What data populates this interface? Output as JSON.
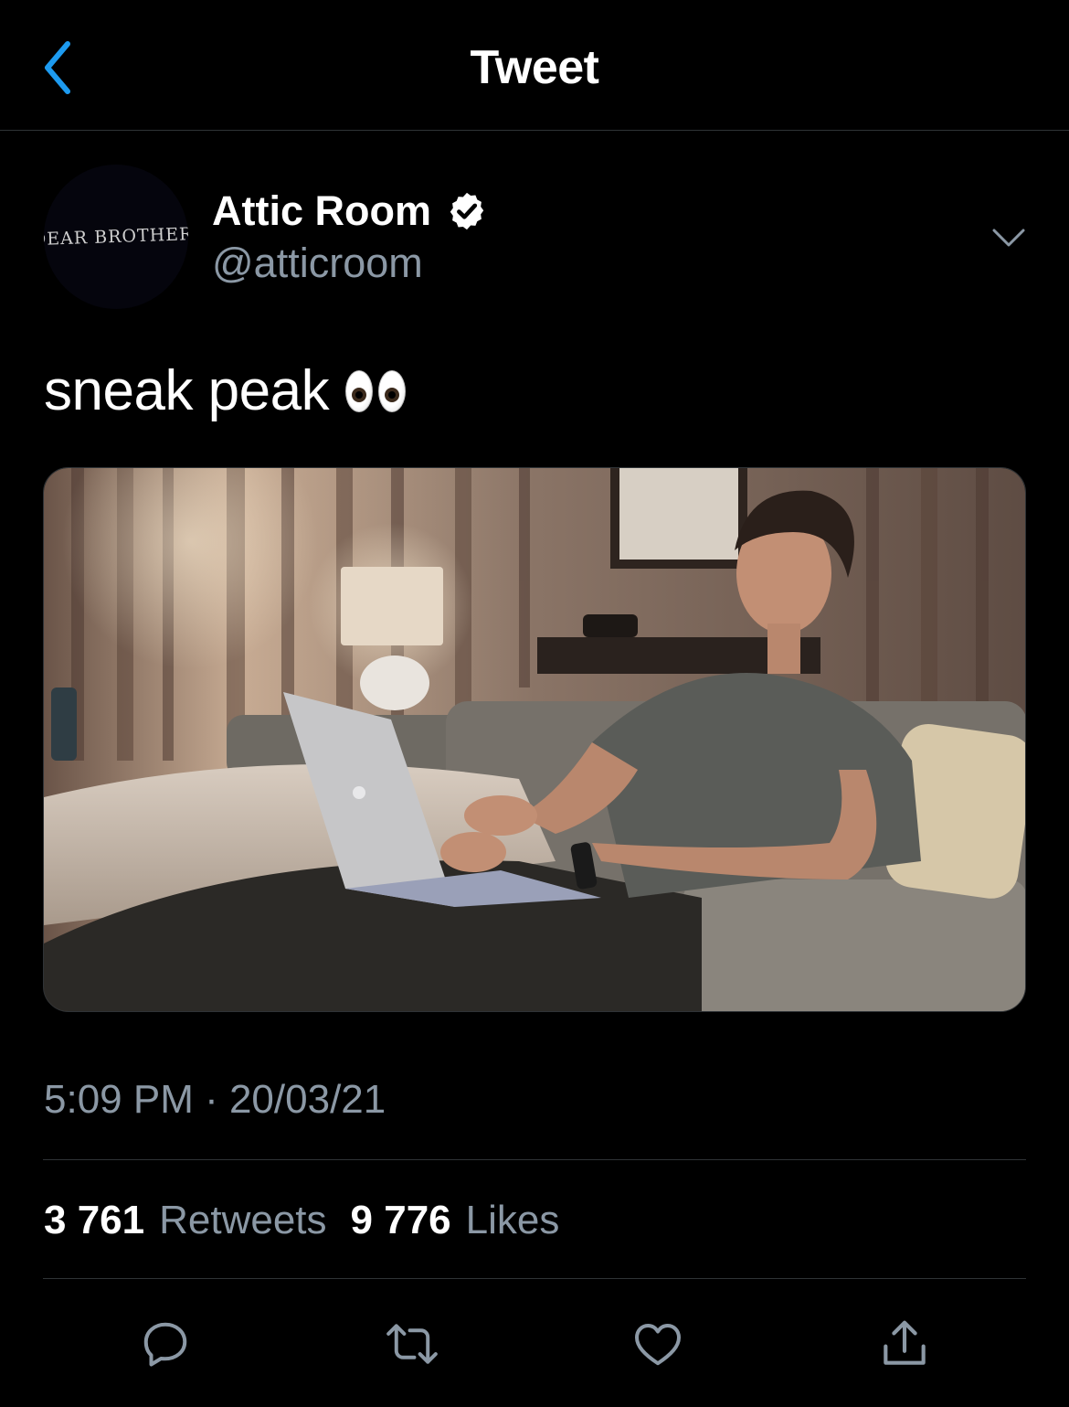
{
  "header": {
    "title": "Tweet",
    "back_icon": "chevron-left-icon"
  },
  "tweet": {
    "author": {
      "display_name": "Attic Room",
      "handle": "@atticroom",
      "verified": true,
      "avatar_text": "DEAR BROTHER,"
    },
    "text": "sneak peak",
    "emoji": "eyes",
    "media": {
      "type": "photo"
    },
    "timestamp": "5:09 PM · 20/03/21",
    "stats": {
      "retweets_count": "3 761",
      "retweets_label": "Retweets",
      "likes_count": "9 776",
      "likes_label": "Likes"
    },
    "actions": [
      "reply-icon",
      "retweet-icon",
      "like-icon",
      "share-icon"
    ]
  },
  "colors": {
    "background": "#000000",
    "accent": "#1d9bf0",
    "secondary_text": "#8b98a5",
    "divider": "#2f3336"
  }
}
